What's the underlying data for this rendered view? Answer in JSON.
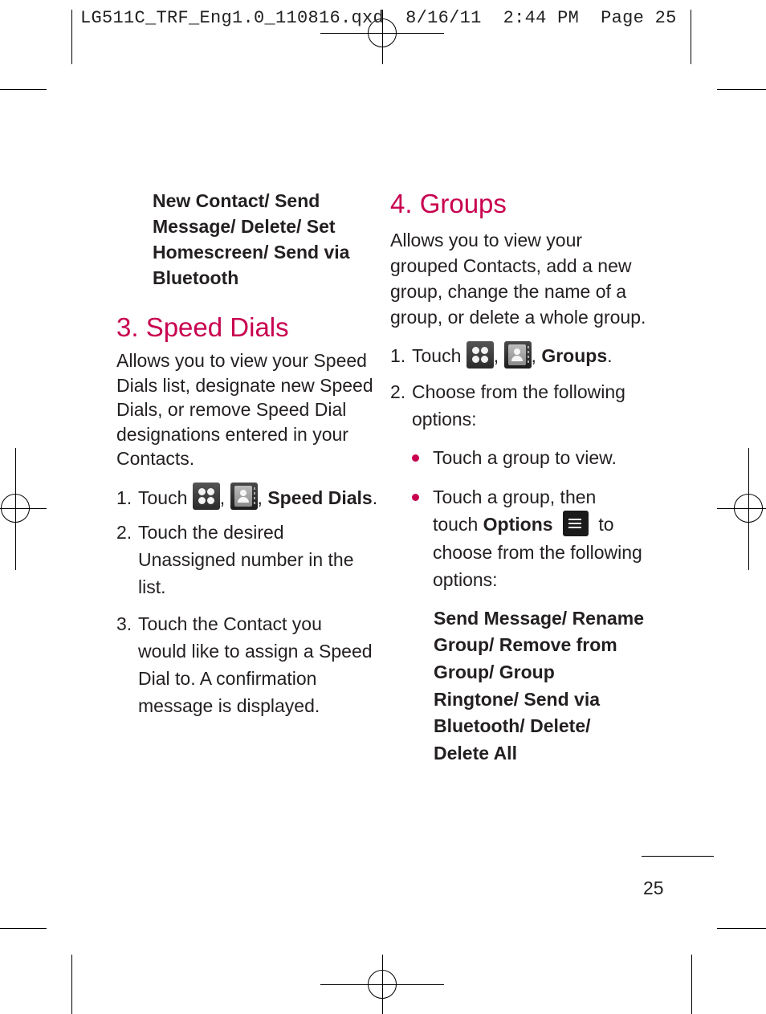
{
  "slug": "LG511C_TRF_Eng1.0_110816.qxd  8/16/11  2:44 PM  Page 25",
  "left_column": {
    "options_list": [
      "New Contact/ Send",
      "Message/ Delete/ Set",
      "Homescreen/ Send via",
      "Bluetooth"
    ],
    "section_title": "3. Speed Dials",
    "intro": [
      "Allows you to view your Speed",
      "Dials list, designate new Speed",
      "Dials, or remove Speed Dial",
      "designations entered in your",
      "Contacts."
    ],
    "steps": [
      {
        "num": "1.",
        "prefix": "Touch",
        "sep1": ",",
        "sep2": ",",
        "target": "Speed Dials",
        "end": ".",
        "icons": [
          "apps-icon",
          "contacts-icon"
        ]
      },
      {
        "num": "2.",
        "lines": [
          "Touch the desired",
          "Unassigned number in the",
          "list."
        ]
      },
      {
        "num": "3.",
        "lines": [
          "Touch the Contact you",
          "would like to assign a Speed",
          "Dial to. A confirmation",
          "message is displayed."
        ]
      }
    ]
  },
  "right_column": {
    "section_title": "4. Groups",
    "intro": [
      "Allows you to view your",
      "grouped Contacts, add a new",
      "group, change the name of a",
      "group, or delete a whole group."
    ],
    "steps": [
      {
        "num": "1.",
        "prefix": "Touch",
        "sep1": ",",
        "sep2": ",",
        "target": "Groups",
        "end": ".",
        "icons": [
          "apps-icon",
          "contacts-icon"
        ]
      },
      {
        "num": "2.",
        "lines": [
          "Choose from the following",
          "options:"
        ]
      }
    ],
    "bullets": [
      {
        "text": "Touch a group to view."
      },
      {
        "line1": "Touch a group, then",
        "line2_prefix": "touch",
        "line2_bold": "Options",
        "line2_suffix": "to",
        "line3": "choose from the following",
        "line4": "options:"
      }
    ],
    "options_list": [
      "Send Message/ Rename",
      "Group/ Remove from",
      "Group/ Group",
      "Ringtone/ Send via",
      "Bluetooth/ Delete/",
      "Delete All"
    ]
  },
  "footer": {
    "page_number": "25"
  },
  "colors": {
    "accent": "#c8004f",
    "text": "#231f20"
  }
}
